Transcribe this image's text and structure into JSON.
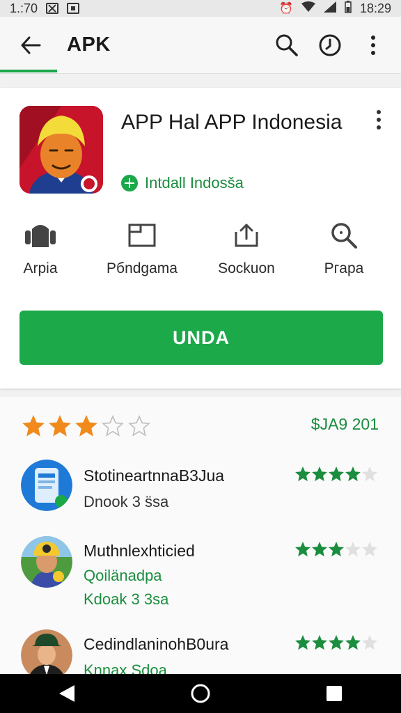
{
  "status_bar": {
    "time_left": "1.:70",
    "time_right": "18:29",
    "icons": [
      "screenshot-icon",
      "download-icon",
      "alarm-icon",
      "wifi-icon",
      "signal-icon",
      "battery-icon"
    ]
  },
  "app_bar": {
    "title": "APK",
    "back_icon": "arrow-left-icon",
    "actions": [
      "search-icon",
      "history-icon",
      "more-vert-icon"
    ]
  },
  "app": {
    "name": "APP Hal APP Indonesia",
    "developer": "Intdall Indosša",
    "icon_name": "app-icon"
  },
  "quick_actions": [
    {
      "label": "Arpia",
      "icon": "android-icon"
    },
    {
      "label": "Pбndgama",
      "icon": "folder-icon"
    },
    {
      "label": "Sockuon",
      "icon": "share-icon"
    },
    {
      "label": "Pгapa",
      "icon": "search-icon"
    }
  ],
  "install_button": {
    "label": "UNDA"
  },
  "rating_summary": {
    "stars_filled": 3,
    "stars_total": 5,
    "score_text": "$JA9 201"
  },
  "reviews": [
    {
      "name": "StotineartnnaB3Jua",
      "lines": [
        "Dnook 3 s̈sa"
      ],
      "line_styles": [
        "dark"
      ],
      "stars_filled": 4,
      "stars_total": 5
    },
    {
      "name": "Muthnlexhticied",
      "lines": [
        "Qoilänadpa",
        "Kdoak 3 3sa"
      ],
      "line_styles": [
        "green",
        "green"
      ],
      "stars_filled": 3,
      "stars_total": 5
    },
    {
      "name": "CedindlaninohB0ura",
      "lines": [
        "Knnax Sdoa"
      ],
      "line_styles": [
        "green"
      ],
      "stars_filled": 4,
      "stars_total": 5
    }
  ],
  "colors": {
    "accent": "#1ca94a",
    "accent_text": "#1b8d3e",
    "star_orange": "#f18a1c",
    "star_green": "#1b8d3e"
  },
  "nav_bar": [
    "back-triangle-icon",
    "home-circle-icon",
    "recents-square-icon"
  ]
}
